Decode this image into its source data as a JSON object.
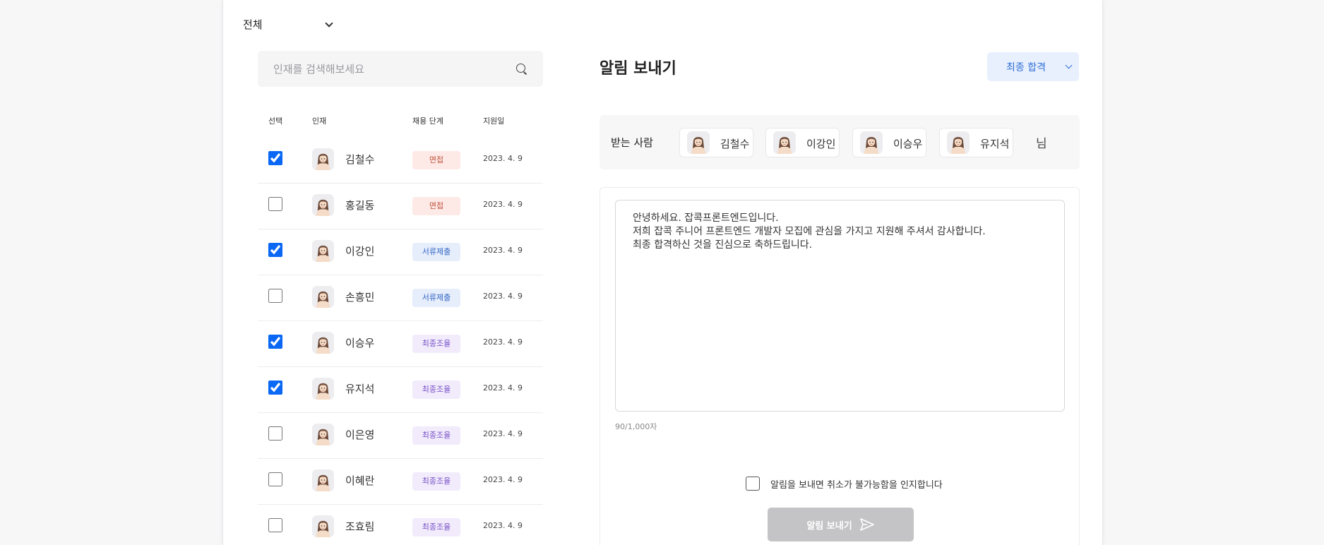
{
  "filter": {
    "label": "전체"
  },
  "search": {
    "placeholder": "인재를 검색해보세요"
  },
  "table": {
    "headers": {
      "select": "선택",
      "talent": "인재",
      "stage": "채용 단계",
      "date": "지원일"
    },
    "rows": [
      {
        "name": "김철수",
        "stage": "면접",
        "stage_type": "interview",
        "date": "2023. 4. 9",
        "checked": true
      },
      {
        "name": "홍길동",
        "stage": "면접",
        "stage_type": "interview",
        "date": "2023. 4. 9",
        "checked": false
      },
      {
        "name": "이강인",
        "stage": "서류제출",
        "stage_type": "document",
        "date": "2023. 4. 9",
        "checked": true
      },
      {
        "name": "손흥민",
        "stage": "서류제출",
        "stage_type": "document",
        "date": "2023. 4. 9",
        "checked": false
      },
      {
        "name": "이승우",
        "stage": "최종조율",
        "stage_type": "final",
        "date": "2023. 4. 9",
        "checked": true
      },
      {
        "name": "유지석",
        "stage": "최종조율",
        "stage_type": "final",
        "date": "2023. 4. 9",
        "checked": true
      },
      {
        "name": "이은영",
        "stage": "최종조율",
        "stage_type": "final",
        "date": "2023. 4. 9",
        "checked": false
      },
      {
        "name": "이혜란",
        "stage": "최종조율",
        "stage_type": "final",
        "date": "2023. 4. 9",
        "checked": false
      },
      {
        "name": "조효림",
        "stage": "최종조율",
        "stage_type": "final",
        "date": "2023. 4. 9",
        "checked": false
      }
    ]
  },
  "stage_colors": {
    "interview": {
      "bg": "#fde9e6",
      "fg": "#c0533d"
    },
    "document": {
      "bg": "#e6eefc",
      "fg": "#3566c4"
    },
    "final": {
      "bg": "#f1ebfc",
      "fg": "#7a51c7"
    }
  },
  "panel": {
    "title": "알림 보내기",
    "stage_select": "최종 합격",
    "recipients_label": "받는 사람",
    "recipients": [
      "김철수",
      "이강인",
      "이승우",
      "유지석"
    ],
    "suffix": "님",
    "message_lines": [
      "안녕하세요. 잡콕프론트엔드입니다.",
      "저희 잡콕 주니어 프론트엔드 개발자 모집에 관심을 가지고 지원해 주셔서 감사합니다.",
      "최종 합격하신 것을 진심으로 축하드립니다."
    ],
    "char_count": "90/1,000자",
    "confirm_label": "알림을 보내면 취소가 불가능함을 인지합니다",
    "confirm_checked": false,
    "send_label": "알림 보내기"
  },
  "colors": {
    "accent": "#0a68f5",
    "disabled_button": "#c4c4c6"
  },
  "icons": {
    "search": "search-icon",
    "dropdown": "chevron-down-icon",
    "send": "paper-plane-icon",
    "avatar": "avatar"
  }
}
